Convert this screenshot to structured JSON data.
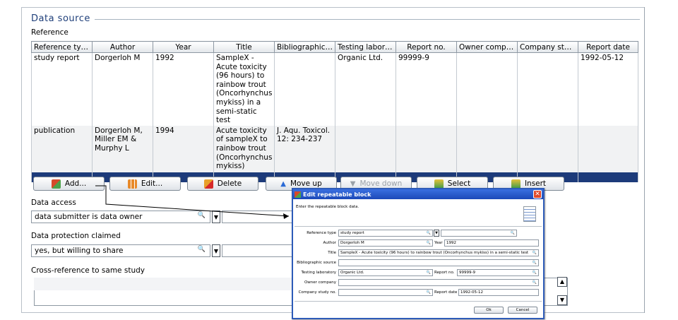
{
  "data_source": {
    "title": "Data source",
    "reference_label": "Reference",
    "columns": [
      "Reference type",
      "Author",
      "Year",
      "Title",
      "Bibliographic s...",
      "Testing laborat...",
      "Report no.",
      "Owner company",
      "Company stud...",
      "Report date"
    ],
    "rows": [
      {
        "reference_type": "study report",
        "author": "Dorgerloh M",
        "year": "1992",
        "title": "SampleX - Acute toxicity (96 hours) to rainbow trout (Oncorhynchus mykiss) in a semi-static test",
        "bibliographic_source": "",
        "testing_laboratory": "Organic Ltd.",
        "report_no": "99999-9",
        "owner_company": "",
        "company_study_no": "",
        "report_date": "1992-05-12"
      },
      {
        "reference_type": "publication",
        "author": "Dorgerloh M, Miller EM & Murphy L",
        "year": "1994",
        "title": "Acute toxicity of sampleX to rainbow trout (Oncorhynchus mykiss)",
        "bibliographic_source": "J. Aqu. Toxicol. 12: 234-237",
        "testing_laboratory": "",
        "report_no": "",
        "owner_company": "",
        "company_study_no": "",
        "report_date": ""
      }
    ]
  },
  "toolbar": {
    "add": "Add...",
    "edit": "Edit...",
    "delete": "Delete",
    "move_up": "Move up",
    "move_down": "Move down",
    "select": "Select",
    "insert": "Insert"
  },
  "data_access": {
    "label": "Data access",
    "value": "data submitter is data owner"
  },
  "data_protection": {
    "label": "Data protection claimed",
    "value": "yes, but willing to share"
  },
  "cross_reference": {
    "label": "Cross-reference to same study"
  },
  "dialog": {
    "title": "Edit repeatable block",
    "instruction": "Enter the repeatable block data.",
    "reference_type_label": "Reference type",
    "reference_type_value": "study report",
    "author_label": "Author",
    "author_value": "Dorgerloh M",
    "year_label": "Year",
    "year_value": "1992",
    "title_label": "Title",
    "title_value": "SampleX - Acute toxicity (96 hours) to rainbow trout (Oncorhynchus mykiss) in a semi-static test",
    "biblio_label": "Bibliographic source",
    "biblio_value": "",
    "lab_label": "Testing laboratory",
    "lab_value": "Organic Ltd.",
    "report_no_label": "Report no.",
    "report_no_value": "99999-9",
    "owner_label": "Owner company",
    "owner_value": "",
    "study_no_label": "Company study no.",
    "study_no_value": "",
    "report_date_label": "Report date",
    "report_date_value": "1992-05-12",
    "ok": "Ok",
    "cancel": "Cancel"
  },
  "colors": {
    "section_title": "#1f3f7a",
    "selected_row": "#1d3b7a",
    "dialog_titlebar": "#1c49b8"
  }
}
